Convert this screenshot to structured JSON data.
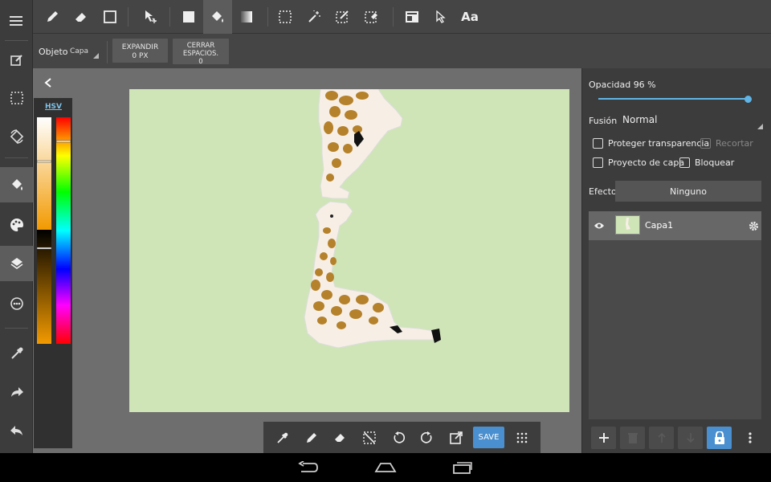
{
  "domain": "Computer-Use",
  "left_rail": {
    "items": [
      {
        "name": "menu-icon"
      },
      {
        "name": "edit-canvas-icon"
      },
      {
        "name": "select-icon"
      },
      {
        "name": "rotate-canvas-icon"
      },
      {
        "name": "fill-icon"
      },
      {
        "name": "palette-icon"
      },
      {
        "name": "layers-icon"
      },
      {
        "name": "filters-icon"
      },
      {
        "name": "eyedropper-icon"
      },
      {
        "name": "redo-icon"
      },
      {
        "name": "undo-icon"
      }
    ]
  },
  "top_toolbar": {
    "tools": [
      {
        "name": "pen-tool"
      },
      {
        "name": "eraser-tool"
      },
      {
        "name": "shape-tool"
      },
      {
        "name": "move-tool"
      },
      {
        "name": "fill-rect-tool"
      },
      {
        "name": "bucket-tool"
      },
      {
        "name": "gradient-tool"
      },
      {
        "name": "select-rect-tool"
      },
      {
        "name": "magic-wand-tool"
      },
      {
        "name": "select-pen-tool"
      },
      {
        "name": "select-eraser-tool"
      },
      {
        "name": "frame-tool"
      },
      {
        "name": "pointer-tool"
      }
    ],
    "text_tool_label": "Aa"
  },
  "option_bar": {
    "object_label": "Objeto",
    "object_value": "Capa",
    "expand_label": "EXPANDIR",
    "expand_value": "0 PX",
    "close_gaps_label": "CERRAR ESPACIOS.",
    "close_gaps_value": "0"
  },
  "color_panel": {
    "mode_tab": "HSV",
    "colors": {
      "fg": "#f29a00",
      "hue_top": "#ff0000"
    }
  },
  "bottom_toolbar": {
    "tools": [
      {
        "name": "eyedropper-icon"
      },
      {
        "name": "pen-icon"
      },
      {
        "name": "eraser-icon"
      },
      {
        "name": "deselect-icon"
      },
      {
        "name": "rotate-left-icon"
      },
      {
        "name": "rotate-right-icon"
      },
      {
        "name": "export-icon"
      }
    ],
    "save_label": "SAVE"
  },
  "layer_panel": {
    "opacity_label": "Opacidad 96 %",
    "opacity_value": 96,
    "blend_label": "Fusión",
    "blend_value": "Normal",
    "protect_alpha_label": "Proteger transparencia",
    "clipping_label": "Recortar",
    "draft_label": "Proyecto de capa",
    "lock_label": "Bloquear",
    "effect_label": "Efecto",
    "effect_value": "Ninguno",
    "layers": [
      {
        "name": "Capa1"
      }
    ]
  },
  "nav_bar": {
    "buttons": [
      {
        "name": "back-icon"
      },
      {
        "name": "home-icon"
      },
      {
        "name": "recents-icon"
      }
    ]
  },
  "colors": {
    "accent": "#4a8fcf",
    "slider": "#5fb5e6",
    "canvas_bg": "#cfe5b8",
    "giraffe_spot": "#b5812a",
    "giraffe_body": "#f7efe6"
  }
}
